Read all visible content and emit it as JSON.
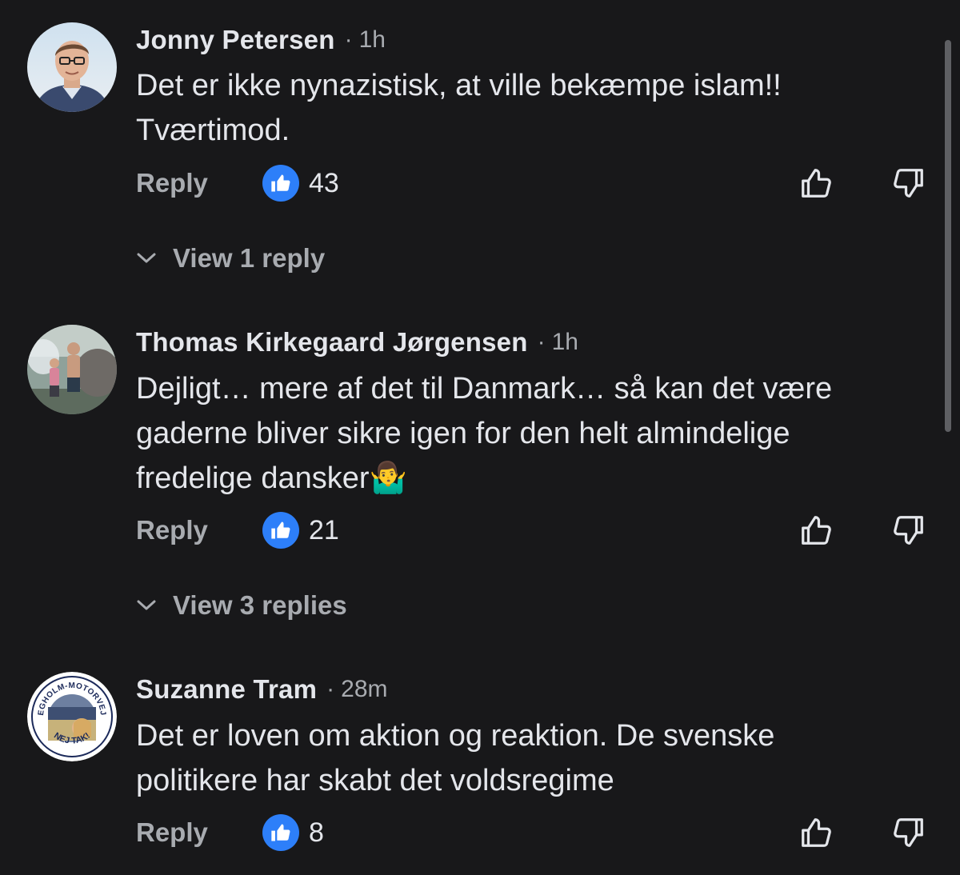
{
  "comments": [
    {
      "author": "Jonny Petersen",
      "separator": "·",
      "time": "1h",
      "text_lines": [
        "Det er ikke nynazistisk, at ville bekæmpe islam!!",
        "Tværtimod."
      ],
      "reply_label": "Reply",
      "likes": "43",
      "view_replies": "View 1 reply",
      "avatar_icon": "man-portrait-avatar"
    },
    {
      "author": "Thomas Kirkegaard Jørgensen",
      "separator": "·",
      "time": "1h",
      "text_lines": [
        "Dejligt… mere af det til Danmark… så kan det være",
        "gaderne bliver sikre igen for den helt almindelige",
        "fredelige dansker"
      ],
      "emoji": "🤷‍♂️",
      "reply_label": "Reply",
      "likes": "21",
      "view_replies": "View 3 replies",
      "avatar_icon": "outdoor-photo-avatar"
    },
    {
      "author": "Suzanne Tram",
      "separator": "·",
      "time": "28m",
      "text_lines": [
        "Det er loven om aktion og reaktion. De svenske",
        "politikere har skabt det voldsregime"
      ],
      "reply_label": "Reply",
      "likes": "8",
      "avatar_icon": "badge-avatar",
      "avatar_badge": {
        "top_text": "EGHOLM-MOTORVEJ",
        "bottom_text": "NEJ TAK!"
      }
    }
  ],
  "colors": {
    "background": "#18181a",
    "text_primary": "#e4e6eb",
    "text_secondary": "#a8abb0",
    "like_blue": "#2d7ff9"
  },
  "icons": {
    "like_badge": "thumbs-up-icon",
    "vote_up": "thumbs-up-outline-icon",
    "vote_down": "thumbs-down-outline-icon",
    "expand": "chevron-down-icon"
  }
}
